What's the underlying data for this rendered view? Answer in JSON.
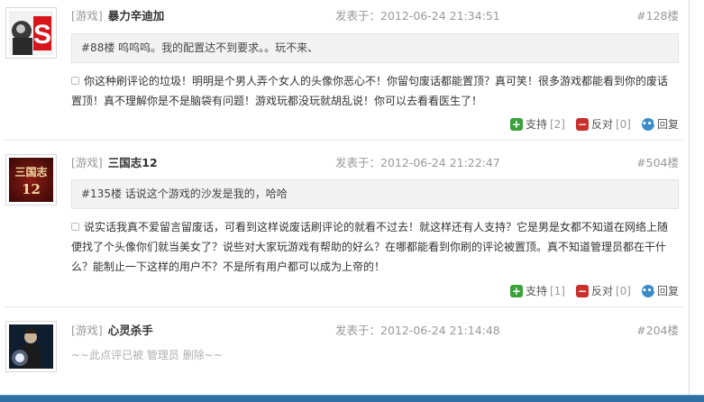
{
  "comments": [
    {
      "game_tag": "[游戏]",
      "username": "暴力辛迪加",
      "posted_label": "发表于：2012-06-24 21:34:51",
      "floor": "#128楼",
      "quote": "#88楼 呜呜呜。我的配置达不到要求。。玩不来、",
      "body_lines": [
        "你这种刷评论的垃圾！明明是个男人弄个女人的头像你恶心不！你留句废话都能置顶？真可笑！很多游戏都能看到你的废话",
        "置顶！真不理解你是不是脑袋有问题！游戏玩都没玩就胡乱说！你可以去看看医生了！"
      ],
      "support_label": "支持",
      "support_count": "[2]",
      "oppose_label": "反对",
      "oppose_count": "[0]",
      "reply_label": "回复"
    },
    {
      "game_tag": "[游戏]",
      "username": "三国志12",
      "posted_label": "发表于：2012-06-24 21:22:47",
      "floor": "#504楼",
      "quote": "#135楼 话说这个游戏的沙发是我的，哈哈",
      "body_lines": [
        "说实话我真不爱留言留废话，可看到这样说废话刷评论的就看不过去！就这样还有人支持？它是男是女都不知道在网络上随",
        "便找了个头像你们就当美女了？说些对大家玩游戏有帮助的好么？在哪都能看到你刷的评论被置顶。真不知道管理员都在干什",
        "么？能制止一下这样的用户不？不是所有用户都可以成为上帝的！"
      ],
      "support_label": "支持",
      "support_count": "[1]",
      "oppose_label": "反对",
      "oppose_count": "[0]",
      "reply_label": "回复",
      "avatar_text": "三国志",
      "avatar_num": "12"
    },
    {
      "game_tag": "[游戏]",
      "username": "心灵杀手",
      "posted_label": "发表于：2012-06-24 21:14:48",
      "floor": "#204楼",
      "deleted_note": "~~此点评已被 管理员 删除~~"
    }
  ],
  "icons": {
    "support": "plus-icon",
    "oppose": "minus-icon",
    "reply": "speech-bubble-icon"
  },
  "colors": {
    "support_green": "#3aa03a",
    "oppose_red": "#c9302c",
    "reply_blue": "#3a8cc9",
    "bottom_bar": "#2f6fa3"
  }
}
